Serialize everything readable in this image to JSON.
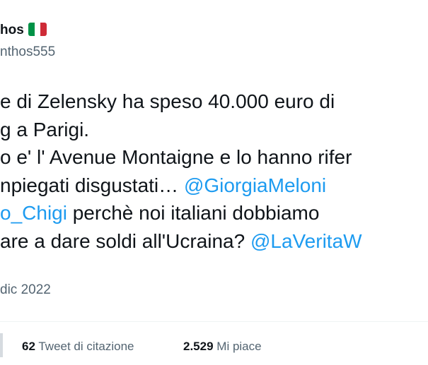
{
  "author": {
    "name_visible": "hos",
    "flag_icon": "italy-flag-icon",
    "handle_visible": "nthos555"
  },
  "tweet": {
    "lines": [
      [
        {
          "text": "e di Zelensky ha speso 40.000 euro di",
          "type": "text"
        }
      ],
      [
        {
          "text": "g a Parigi.",
          "type": "text"
        }
      ],
      [
        {
          "text": "o e' l' Avenue Montaigne e lo hanno rifer",
          "type": "text"
        }
      ],
      [
        {
          "text": "npiegati disgustati… ",
          "type": "text"
        },
        {
          "text": "@GiorgiaMeloni",
          "type": "mention"
        }
      ],
      [
        {
          "text": "o_Chigi",
          "type": "mention"
        },
        {
          "text": " perchè noi italiani dobbiamo",
          "type": "text"
        }
      ],
      [
        {
          "text": "are a dare soldi all'Ucraina? ",
          "type": "text"
        },
        {
          "text": "@LaVeritaW",
          "type": "mention"
        }
      ]
    ]
  },
  "meta": {
    "timestamp_visible": "dic 2022"
  },
  "stats": [
    {
      "number": "62",
      "label": "Tweet di citazione"
    },
    {
      "number": "2.529",
      "label": "Mi piace"
    }
  ],
  "colors": {
    "text": "#0f1419",
    "secondary": "#536471",
    "link": "#1d9bf0",
    "divider": "#eff3f4",
    "flag_green": "#009246",
    "flag_white": "#ffffff",
    "flag_red": "#ce2b37"
  }
}
